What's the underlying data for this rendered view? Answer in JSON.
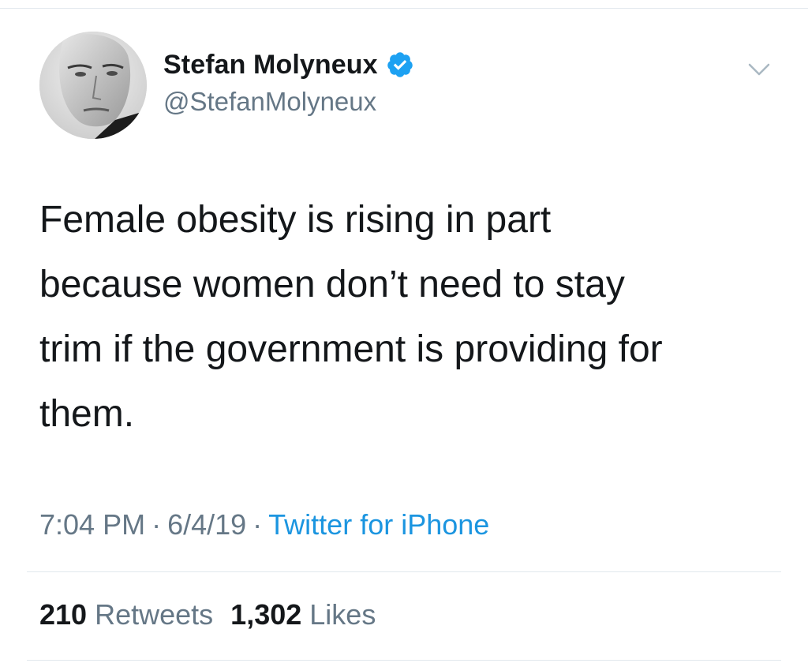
{
  "tweet": {
    "author": {
      "display_name": "Stefan Molyneux",
      "handle": "@StefanMolyneux",
      "verified": true
    },
    "text": "Female obesity is rising in part\nbecause women don’t need to stay\ntrim if the government is providing for\nthem.",
    "time": "7:04 PM",
    "date": "6/4/19",
    "separator": "·",
    "source": "Twitter for iPhone",
    "stats": {
      "retweets_count": "210",
      "retweets_label": "Retweets",
      "likes_count": "1,302",
      "likes_label": "Likes"
    }
  },
  "icons": {
    "verified": "verified-badge-icon",
    "more": "chevron-down-icon"
  },
  "colors": {
    "text_primary": "#14171a",
    "text_secondary": "#657786",
    "link": "#1b95e0",
    "verified": "#1da1f2",
    "divider": "#e1e8ed"
  }
}
